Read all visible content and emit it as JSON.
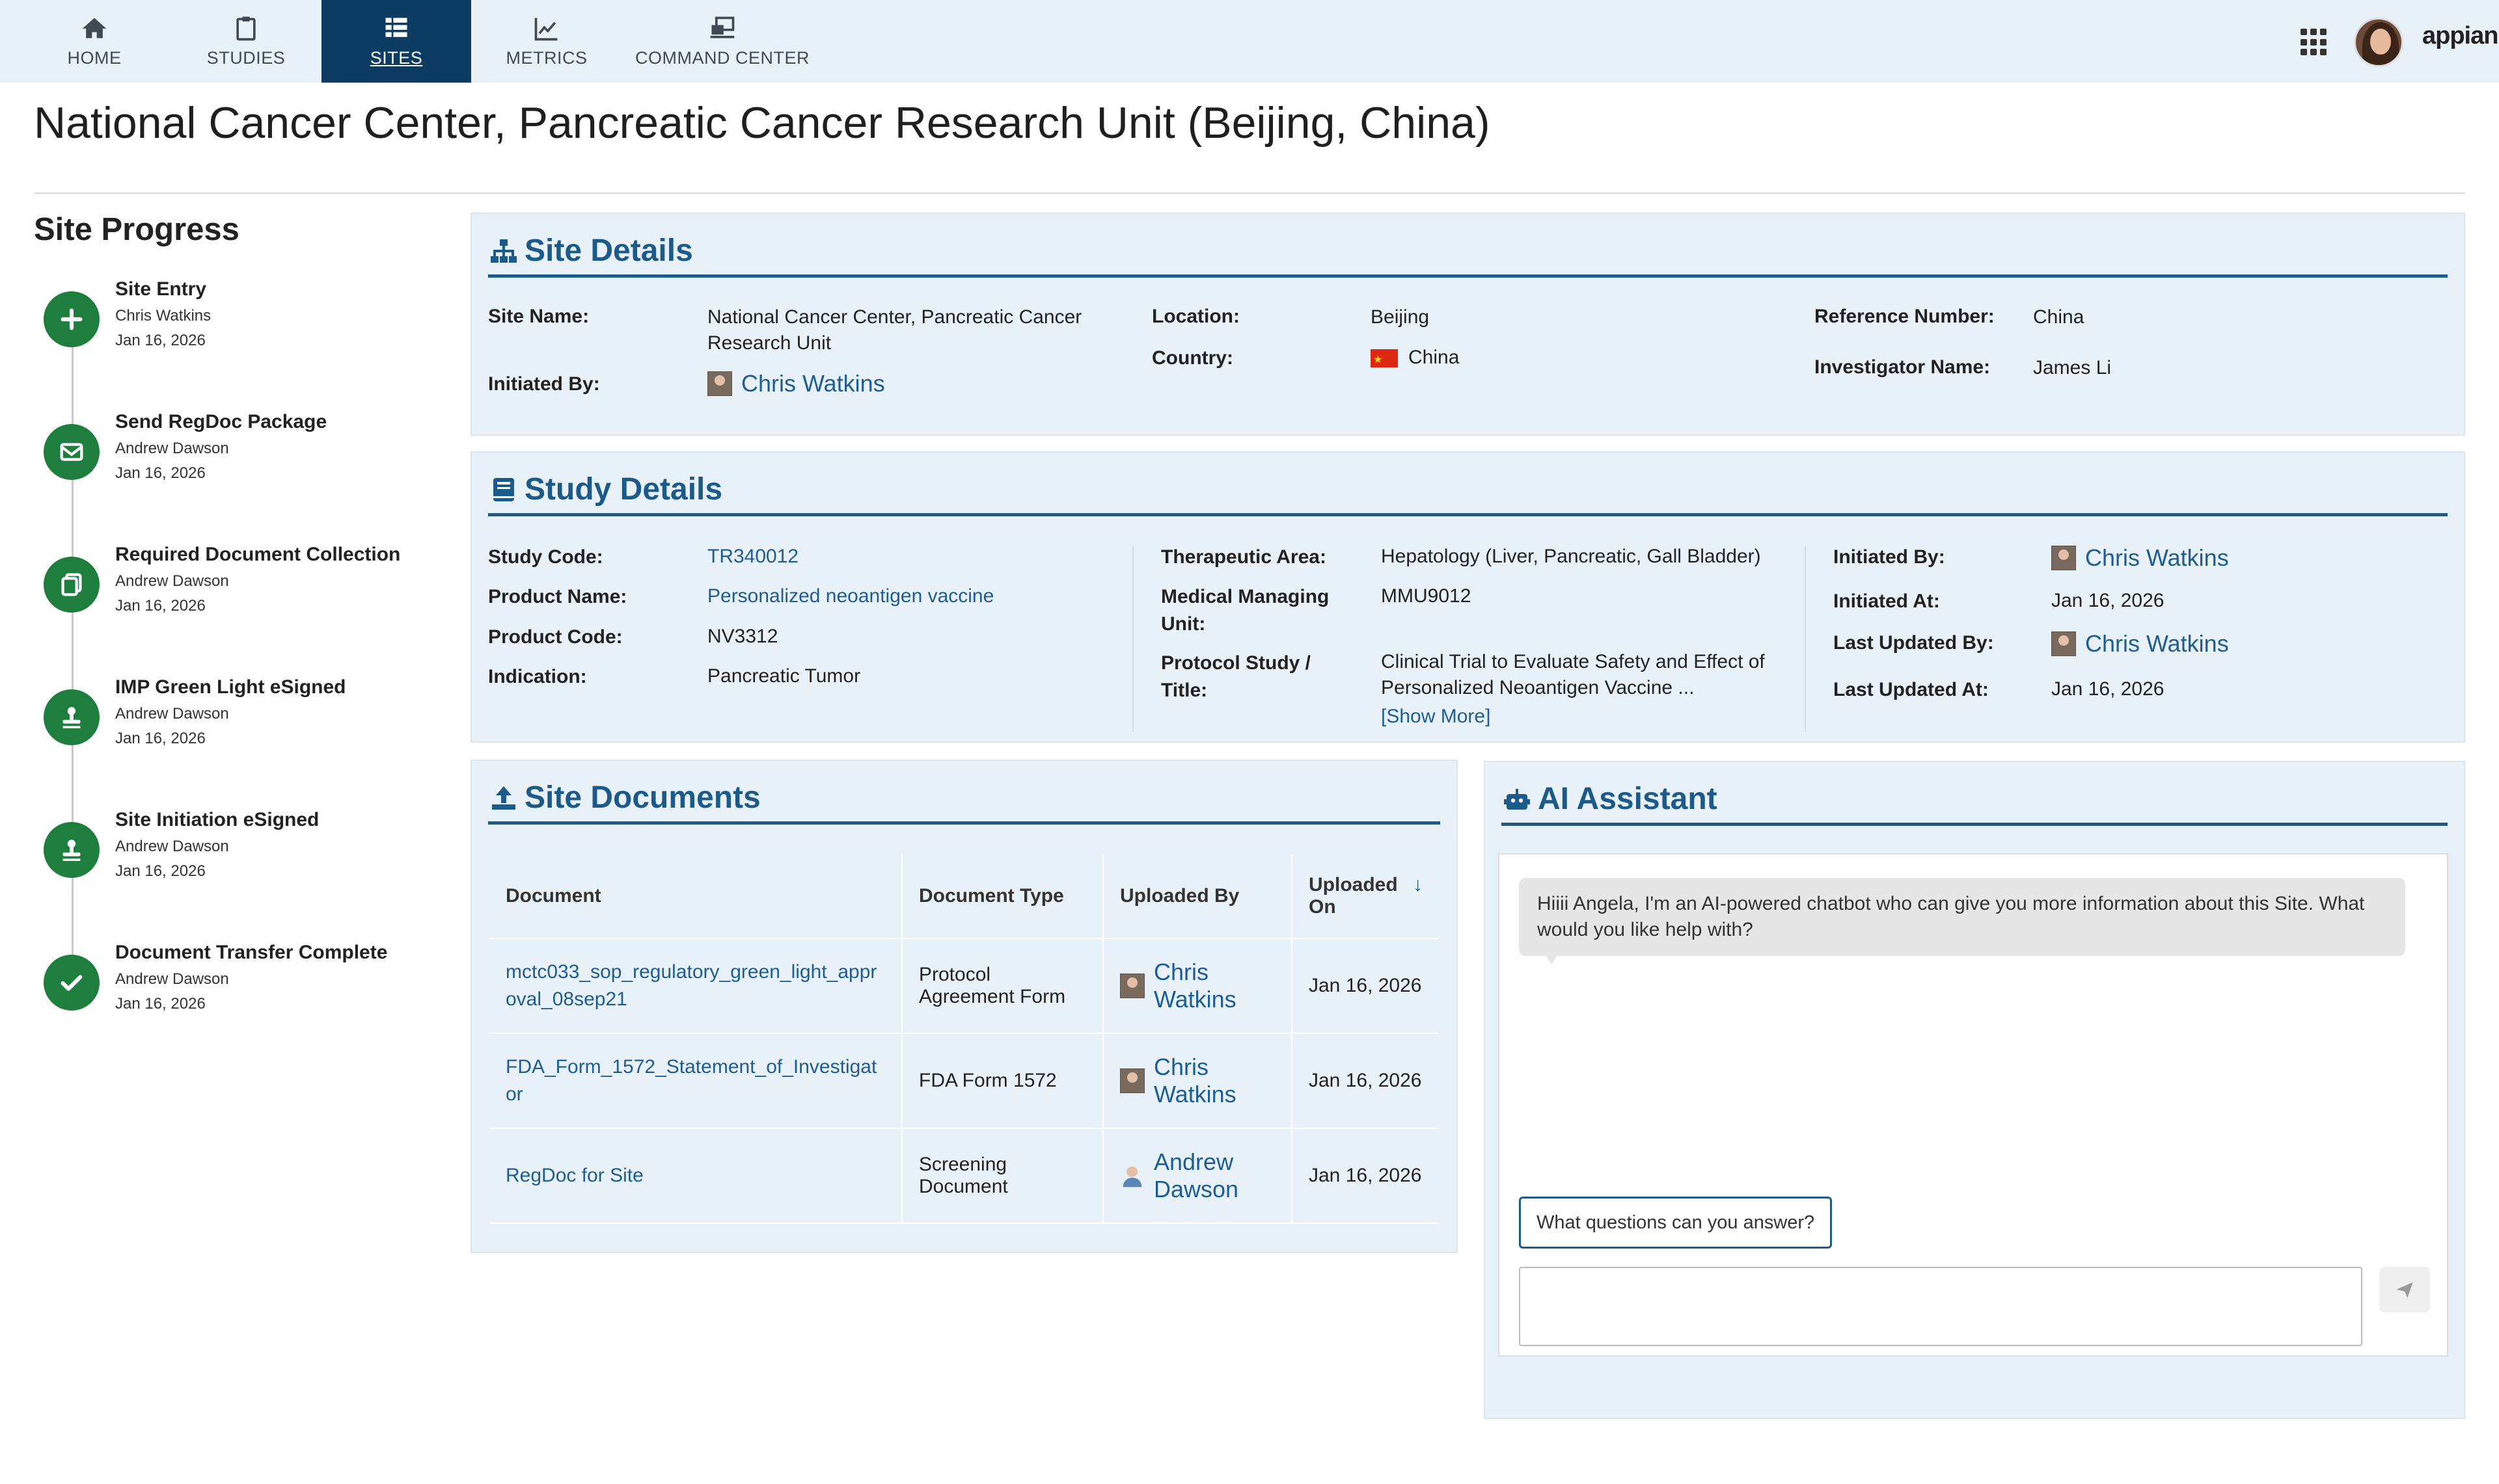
{
  "nav": {
    "tabs": [
      {
        "label": "HOME",
        "icon": "home-icon"
      },
      {
        "label": "STUDIES",
        "icon": "clipboard-icon"
      },
      {
        "label": "SITES",
        "icon": "table-icon",
        "active": true
      },
      {
        "label": "METRICS",
        "icon": "chart-icon"
      },
      {
        "label": "COMMAND CENTER",
        "icon": "command-center-icon"
      }
    ],
    "brand": "appian",
    "active_color": "#0c3c61"
  },
  "page_title": "National Cancer Center, Pancreatic Cancer Research Unit (Beijing, China)",
  "progress": {
    "title": "Site Progress",
    "steps": [
      {
        "title": "Site Entry",
        "user": "Chris Watkins",
        "date": "Jan 16, 2026",
        "icon": "plus-icon"
      },
      {
        "title": "Send RegDoc Package",
        "user": "Andrew Dawson",
        "date": "Jan 16, 2026",
        "icon": "envelope-icon"
      },
      {
        "title": "Required Document Collection",
        "user": "Andrew Dawson",
        "date": "Jan 16, 2026",
        "icon": "copy-icon"
      },
      {
        "title": "IMP Green Light eSigned",
        "user": "Andrew Dawson",
        "date": "Jan 16, 2026",
        "icon": "stamp-icon"
      },
      {
        "title": "Site Initiation eSigned",
        "user": "Andrew Dawson",
        "date": "Jan 16, 2026",
        "icon": "stamp-icon"
      },
      {
        "title": "Document Transfer Complete",
        "user": "Andrew Dawson",
        "date": "Jan 16, 2026",
        "icon": "check-icon"
      }
    ],
    "status_color": "#1e7e3e"
  },
  "site_details": {
    "title": "Site Details",
    "site_name_label": "Site Name:",
    "site_name": "National Cancer Center, Pancreatic Cancer Research Unit",
    "initiated_by_label": "Initiated By:",
    "initiated_by": "Chris Watkins",
    "location_label": "Location:",
    "location": "Beijing",
    "country_label": "Country:",
    "country": "China",
    "reference_label": "Reference Number:",
    "reference": "China",
    "investigator_label": "Investigator Name:",
    "investigator": "James Li"
  },
  "study_details": {
    "title": "Study Details",
    "study_code_label": "Study Code:",
    "study_code": "TR340012",
    "product_name_label": "Product Name:",
    "product_name": "Personalized neoantigen vaccine",
    "product_code_label": "Product Code:",
    "product_code": "NV3312",
    "indication_label": "Indication:",
    "indication": "Pancreatic Tumor",
    "therapeutic_label": "Therapeutic Area:",
    "therapeutic": "Hepatology (Liver, Pancreatic, Gall Bladder)",
    "managing_label": "Medical Managing Unit:",
    "managing": "MMU9012",
    "protocol_label": "Protocol Study / Title:",
    "protocol": "Clinical Trial to Evaluate Safety and Effect of Personalized Neoantigen Vaccine ...",
    "show_more": "[Show More]",
    "initiated_by_label": "Initiated By:",
    "initiated_by": "Chris Watkins",
    "initiated_at_label": "Initiated At:",
    "initiated_at": "Jan 16, 2026",
    "updated_by_label": "Last Updated By:",
    "updated_by": "Chris Watkins",
    "updated_at_label": "Last Updated At:",
    "updated_at": "Jan 16, 2026"
  },
  "site_documents": {
    "title": "Site Documents",
    "columns": [
      "Document",
      "Document Type",
      "Uploaded By",
      "Uploaded On"
    ],
    "sort_indicator": "↓",
    "rows": [
      {
        "document": "mctc033_sop_regulatory_green_light_approval_08sep21",
        "type": "Protocol Agreement Form",
        "uploaded_by": "Chris Watkins",
        "uploaded_on": "Jan 16, 2026"
      },
      {
        "document": "FDA_Form_1572_Statement_of_Investigator",
        "type": "FDA Form 1572",
        "uploaded_by": "Chris Watkins",
        "uploaded_on": "Jan 16, 2026"
      },
      {
        "document": "RegDoc for Site",
        "type": "Screening Document",
        "uploaded_by": "Andrew Dawson",
        "uploaded_on": "Jan 16, 2026"
      }
    ]
  },
  "ai_assistant": {
    "title": "AI Assistant",
    "greeting": "Hiiii Angela, I'm an AI-powered chatbot who can give you more information about this Site. What would you like help with?",
    "suggestion": "What questions can you answer?",
    "input_value": ""
  },
  "colors": {
    "accent": "#1c5a8a",
    "card_bg": "#e9f1f8",
    "link": "#1d5d93"
  }
}
